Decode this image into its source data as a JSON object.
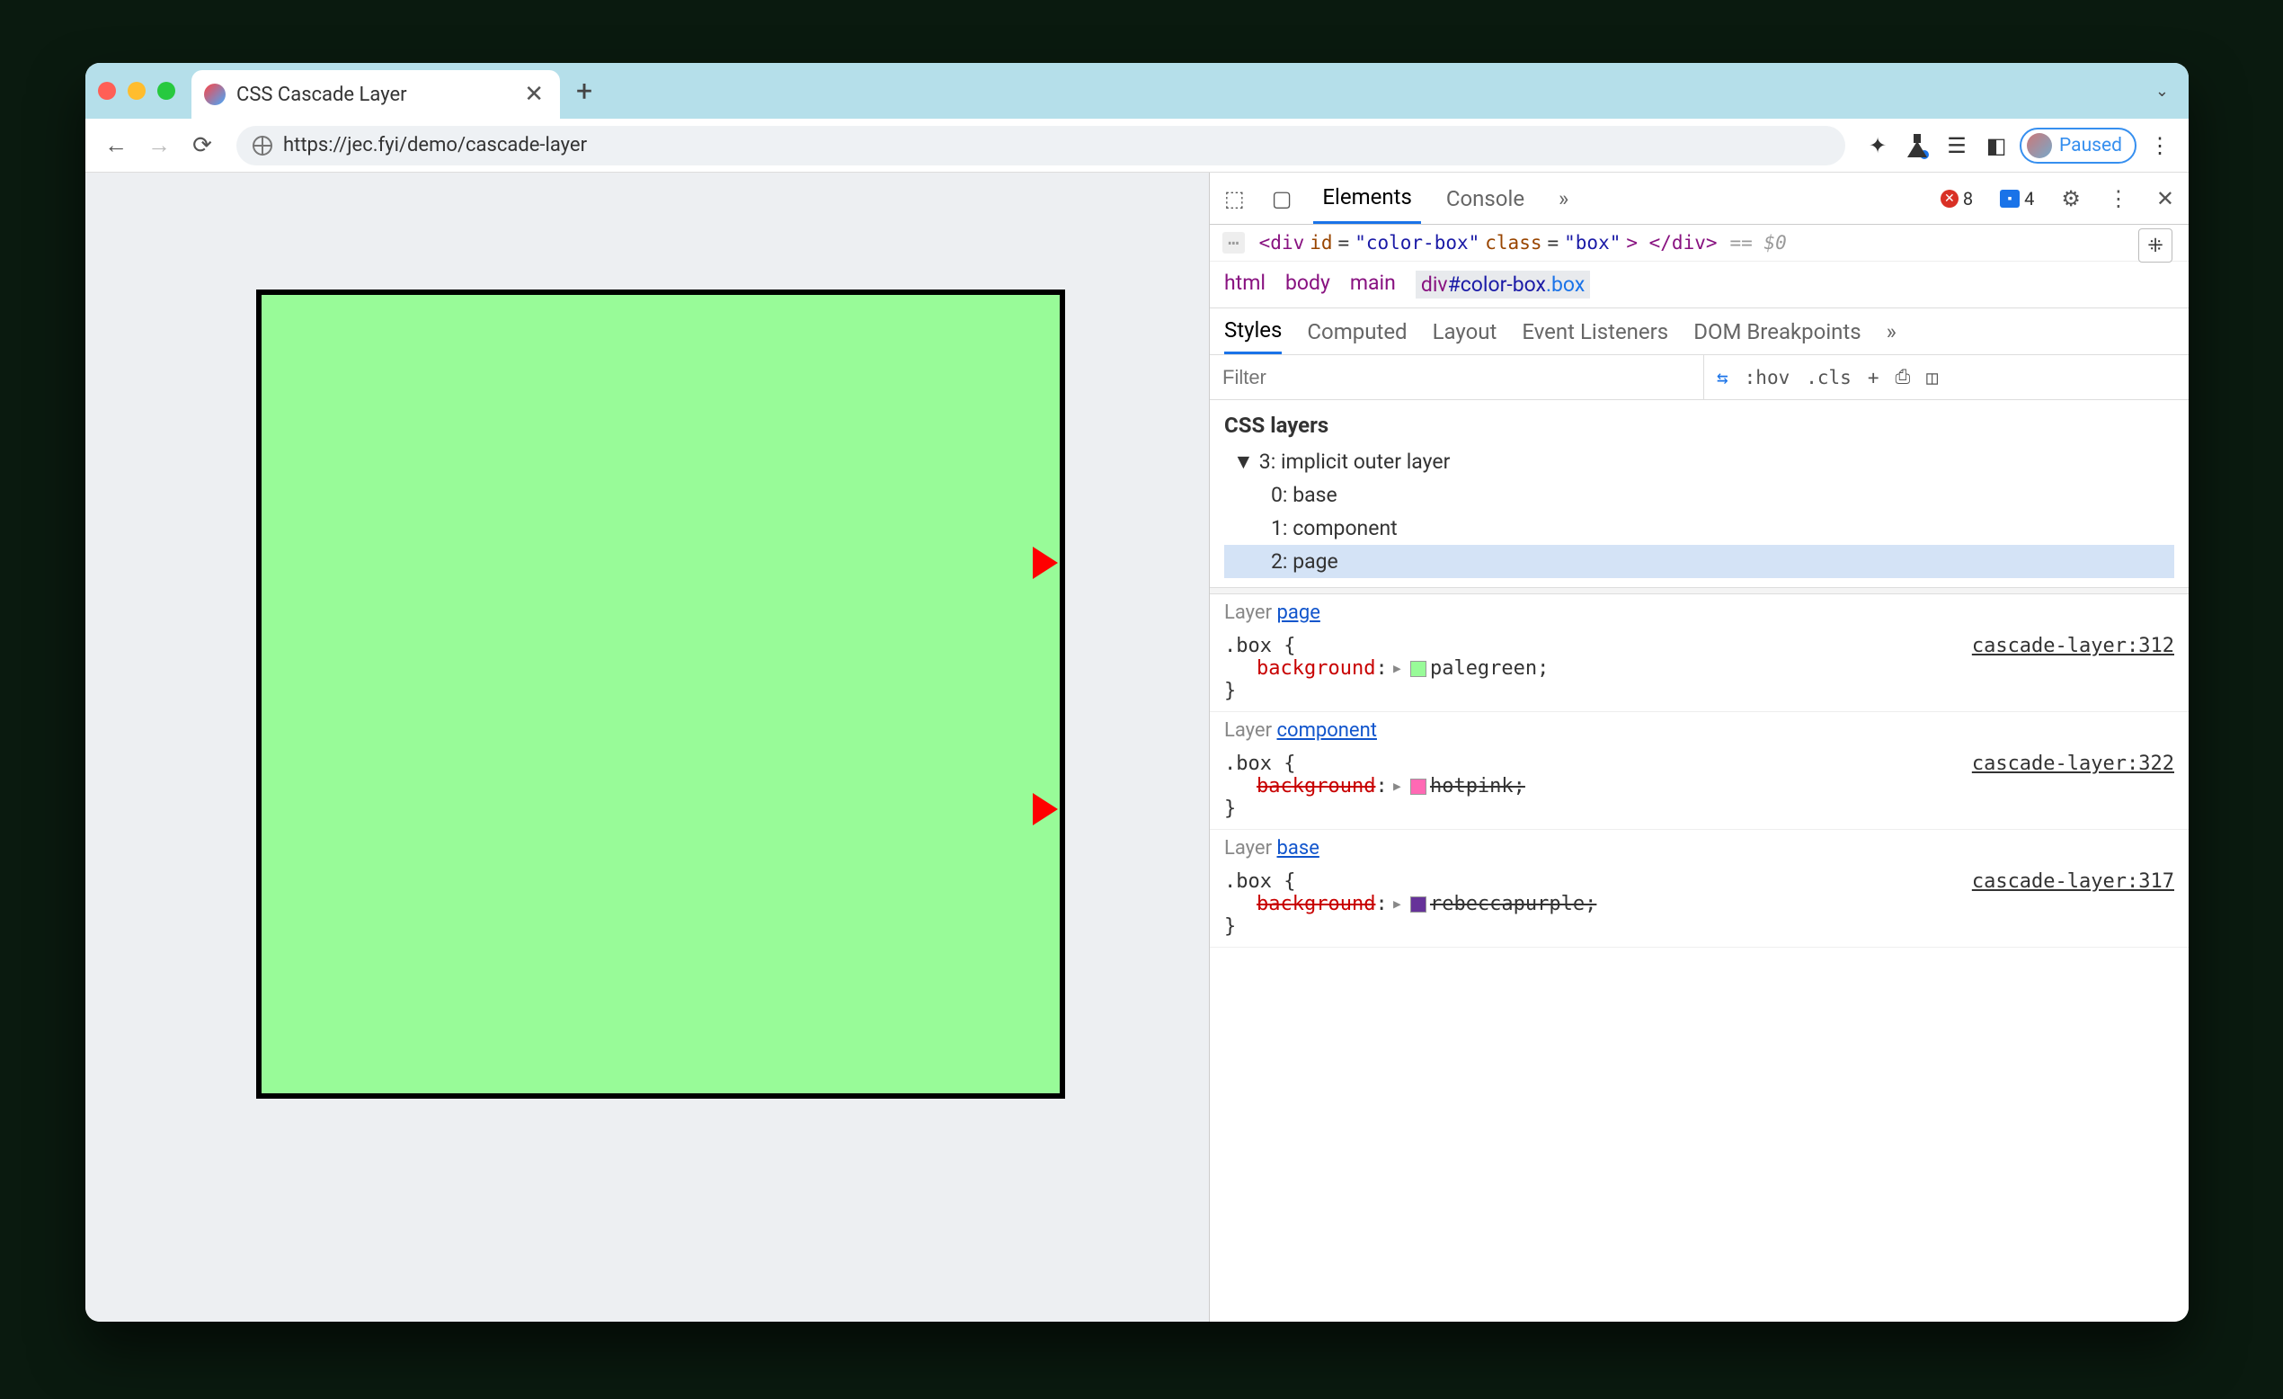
{
  "tab": {
    "title": "CSS Cascade Layer"
  },
  "url": "https://jec.fyi/demo/cascade-layer",
  "paused_label": "Paused",
  "devtools": {
    "tabs": {
      "elements": "Elements",
      "console": "Console",
      "more": "»"
    },
    "counts": {
      "errors": "8",
      "messages": "4"
    },
    "dom": {
      "open": "<div",
      "id_attr": "id",
      "id_val": "\"color-box\"",
      "class_attr": "class",
      "class_val": "\"box\"",
      "close": "> </div>",
      "suffix": "== $0"
    },
    "breadcrumbs": [
      "html",
      "body",
      "main"
    ],
    "breadcrumb_selected": {
      "tag": "div",
      "id": "#color-box",
      "cls": ".box"
    },
    "subtabs": {
      "styles": "Styles",
      "computed": "Computed",
      "layout": "Layout",
      "events": "Event Listeners",
      "dom_bp": "DOM Breakpoints",
      "more": "»"
    },
    "filter_placeholder": "Filter",
    "filter_tools": {
      "hov": ":hov",
      "cls": ".cls",
      "plus": "+"
    },
    "css_layers_title": "CSS layers",
    "layers_tree": {
      "root": "3: implicit outer layer",
      "children": [
        "0: base",
        "1: component",
        "2: page"
      ]
    },
    "rules": [
      {
        "layer_label": "Layer ",
        "layer_link": "page",
        "selector": ".box {",
        "prop": "background",
        "value": "palegreen",
        "swatch": "#98fb98",
        "strike": false,
        "source": "cascade-layer:312",
        "close": "}"
      },
      {
        "layer_label": "Layer ",
        "layer_link": "component",
        "selector": ".box {",
        "prop": "background",
        "value": "hotpink",
        "swatch": "#ff69b4",
        "strike": true,
        "source": "cascade-layer:322",
        "close": "}"
      },
      {
        "layer_label": "Layer ",
        "layer_link": "base",
        "selector": ".box {",
        "prop": "background",
        "value": "rebeccapurple",
        "swatch": "#663399",
        "strike": true,
        "source": "cascade-layer:317",
        "close": "}"
      }
    ]
  }
}
